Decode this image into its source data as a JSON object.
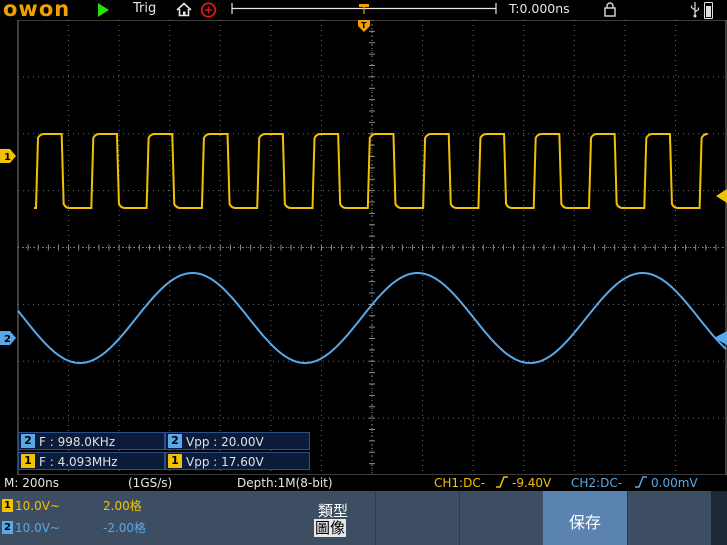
{
  "header": {
    "brand": "owon",
    "run_state": "running",
    "trigger_status": "Trig",
    "trigger_time": "T:0.000ns"
  },
  "channels": {
    "ch1": {
      "marker": "1",
      "color": "#f2c200",
      "waveform": "square"
    },
    "ch2": {
      "marker": "2",
      "color": "#5aa8e8",
      "waveform": "sine"
    }
  },
  "markers": {
    "trigger_top": "T"
  },
  "measurements": [
    {
      "channel": "2",
      "label": "F : 998.0KHz"
    },
    {
      "channel": "2",
      "label": "Vpp : 20.00V"
    },
    {
      "channel": "1",
      "label": "F : 4.093MHz"
    },
    {
      "channel": "1",
      "label": "Vpp : 17.60V"
    }
  ],
  "status": {
    "timebase": "M: 200ns",
    "sample_rate": "(1GS/s)",
    "depth": "Depth:1M(8-bit)",
    "ch1_trigger": "CH1:DC-",
    "ch1_level": "-9.40V",
    "ch2_trigger": "CH2:DC-",
    "ch2_level": "0.00mV"
  },
  "channel_settings": [
    {
      "num": "1",
      "volts": "10.0V~",
      "offset": "2.00格"
    },
    {
      "num": "2",
      "volts": "10.0V~",
      "offset": "-2.00格"
    }
  ],
  "softkeys": {
    "type_title": "類型",
    "type_value": "圖像",
    "save_label": "保存"
  }
}
